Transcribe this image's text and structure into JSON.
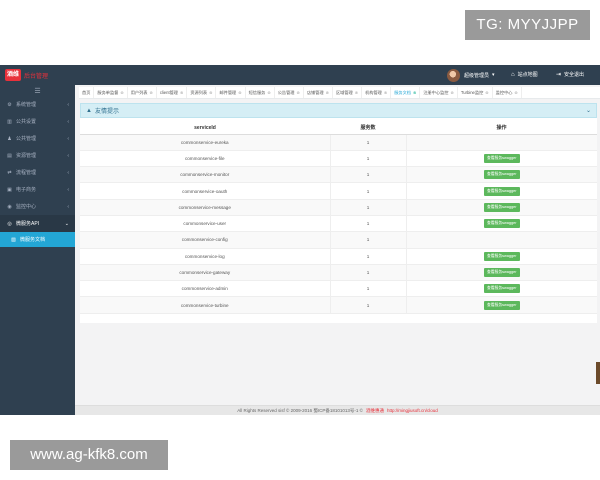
{
  "watermarks": {
    "top": "TG: MYYJJPP",
    "bottom": "www.ag-kfk8.com"
  },
  "topbar": {
    "logo_mark": "酒维",
    "logo_text": "后台管理",
    "user_name": "超级管理员",
    "links": [
      "站点地图",
      "安全退出"
    ]
  },
  "sidebar": {
    "items": [
      {
        "label": "系统管理",
        "icon": "gear-icon"
      },
      {
        "label": "公共设置",
        "icon": "bank-icon"
      },
      {
        "label": "公共管理",
        "icon": "users-icon"
      },
      {
        "label": "资源管理",
        "icon": "folder-icon"
      },
      {
        "label": "流程管理",
        "icon": "flow-icon"
      },
      {
        "label": "电子商务",
        "icon": "cart-icon"
      },
      {
        "label": "监控中心",
        "icon": "monitor-icon"
      },
      {
        "label": "微服务API",
        "icon": "api-icon"
      }
    ],
    "sub_item": "微服务文档"
  },
  "tabs": [
    "首页",
    "服务单监督",
    "用户列表",
    "client管理",
    "资源列表",
    "邮件管理",
    "短信服务",
    "公告管理",
    "店铺管理",
    "区域管理",
    "机构管理",
    "服务文档",
    "注册中心监控",
    "Turbine监控",
    "监控中心"
  ],
  "panel": {
    "title": "友情提示"
  },
  "table": {
    "headers": [
      "serviceId",
      "服务数",
      "操作"
    ],
    "button_label": "查看服务swagger",
    "rows": [
      {
        "service": "commonservice-eureka",
        "count": "1",
        "action": false
      },
      {
        "service": "commonservice-file",
        "count": "1",
        "action": true
      },
      {
        "service": "commonservice-monitor",
        "count": "1",
        "action": true
      },
      {
        "service": "commonservice-oauth",
        "count": "1",
        "action": true
      },
      {
        "service": "commonservice-message",
        "count": "1",
        "action": true
      },
      {
        "service": "commonservice-user",
        "count": "1",
        "action": true
      },
      {
        "service": "commonservice-config",
        "count": "1",
        "action": false
      },
      {
        "service": "commonservice-log",
        "count": "1",
        "action": true
      },
      {
        "service": "commonservice-gateway",
        "count": "1",
        "action": true
      },
      {
        "service": "commonservice-admin",
        "count": "1",
        "action": true
      },
      {
        "service": "commonservice-turbine",
        "count": "1",
        "action": true
      }
    ]
  },
  "footer": {
    "text": "All Rights Reserved sisf © 2009-2016 蜀ICP备18101013号-1 ©",
    "red": "酒维惠通",
    "link": "http://mingjiusoft.cn/cloud"
  }
}
